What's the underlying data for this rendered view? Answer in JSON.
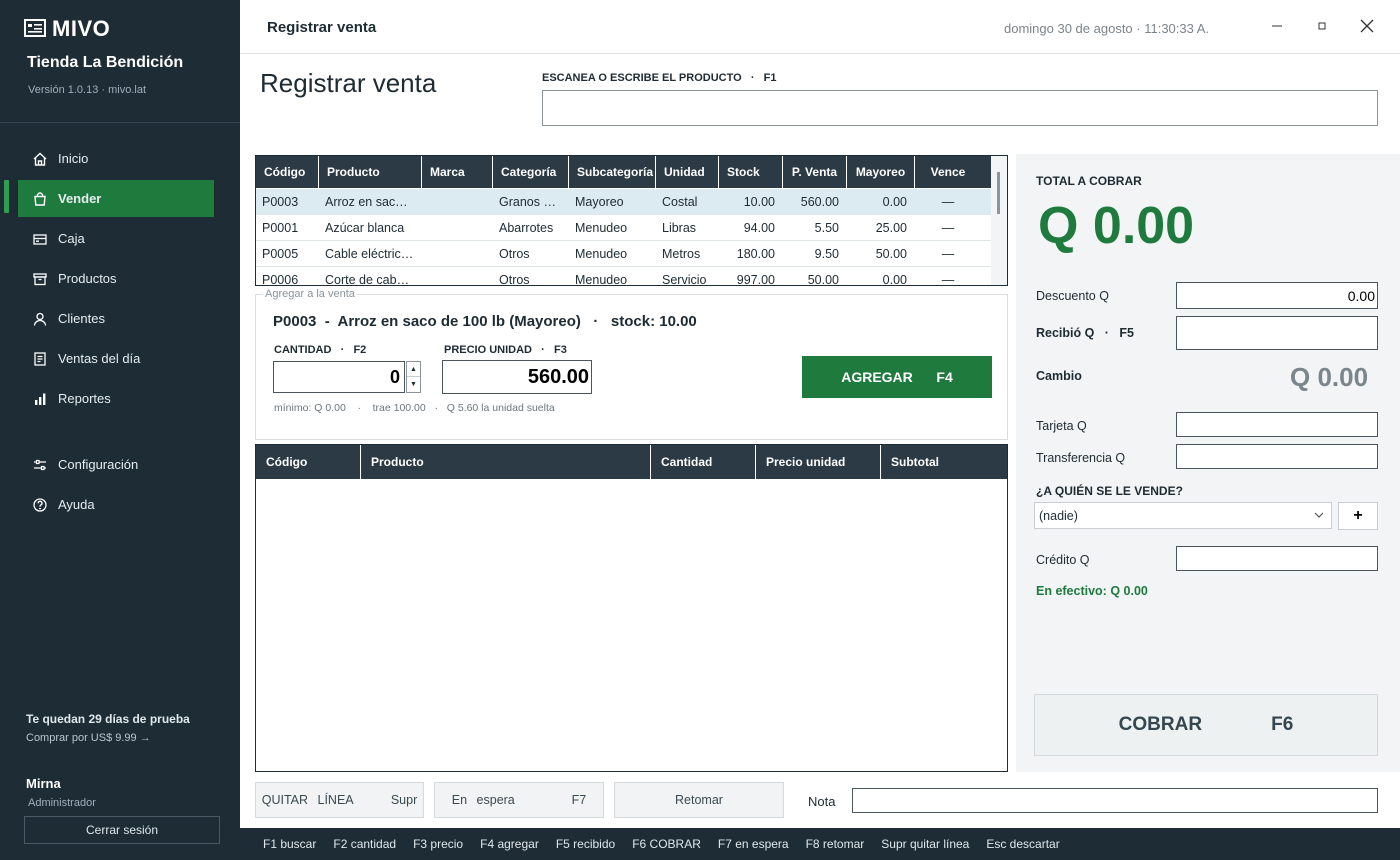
{
  "sidebar": {
    "logo": "MIVO",
    "store_name": "Tienda La Bendición",
    "version": "Versión 1.0.13 · mivo.lat",
    "items": [
      {
        "label": "Inicio"
      },
      {
        "label": "Vender"
      },
      {
        "label": "Caja"
      },
      {
        "label": "Productos"
      },
      {
        "label": "Clientes"
      },
      {
        "label": "Ventas del día"
      },
      {
        "label": "Reportes"
      },
      {
        "label": "Configuración"
      },
      {
        "label": "Ayuda"
      }
    ],
    "trial": "Te quedan 29 días de prueba",
    "trial_link": "Comprar por US$ 9.99 →",
    "user_name": "Mirna",
    "user_role": "Administrador",
    "logout": "Cerrar sesión"
  },
  "window": {
    "title": "Registrar venta",
    "datetime": "domingo 30 de agosto   ·   11:30:33 A."
  },
  "page": {
    "title": "Registrar venta",
    "scan_label": "ESCANEA O ESCRIBE EL PRODUCTO   ·   F1",
    "scan_value": ""
  },
  "products_table": {
    "headers": [
      "Código",
      "Producto",
      "Marca",
      "Categoría",
      "Subcategoría",
      "Unidad",
      "Stock",
      "P. Venta",
      "Mayoreo",
      "Vence"
    ],
    "rows": [
      [
        "P0003",
        "Arroz en sac…",
        "",
        "Granos …",
        "Mayoreo",
        "Costal",
        "10.00",
        "560.00",
        "0.00",
        "—"
      ],
      [
        "P0001",
        "Azúcar blanca",
        "",
        "Abarrotes",
        "Menudeo",
        "Libras",
        "94.00",
        "5.50",
        "25.00",
        "—"
      ],
      [
        "P0005",
        "Cable eléctric…",
        "",
        "Otros",
        "Menudeo",
        "Metros",
        "180.00",
        "9.50",
        "50.00",
        "—"
      ],
      [
        "P0006",
        "Corte de cab…",
        "",
        "Otros",
        "Menudeo",
        "Servicio",
        "997.00",
        "50.00",
        "0.00",
        "—"
      ]
    ]
  },
  "add_panel": {
    "legend": "Agregar a la venta",
    "product_line": "P0003  -  Arroz en saco de 100 lb (Mayoreo)   ·   stock: 10.00",
    "qty_label": "CANTIDAD   ·   F2",
    "qty_value": "0",
    "price_label": "PRECIO UNIDAD   ·   F3",
    "price_value": "560.00",
    "hint": "mínimo: Q 0.00    ·    trae 100.00   ·   Q 5.60 la unidad suelta",
    "add_button": "AGREGAR   F4"
  },
  "cart_table": {
    "headers": [
      "Código",
      "Producto",
      "Cantidad",
      "Precio unidad",
      "Subtotal"
    ]
  },
  "checkout": {
    "total_label": "TOTAL A COBRAR",
    "total_value": "Q 0.00",
    "discount_label": "Descuento Q",
    "discount_value": "0.00",
    "received_label": "Recibió Q   ·   F5",
    "received_value": "",
    "change_label": "Cambio",
    "change_value": "Q 0.00",
    "card_label": "Tarjeta Q",
    "transfer_label": "Transferencia Q",
    "customer_label": "¿A QUIÉN SE LE VENDE?",
    "customer_value": "(nadie)",
    "add_customer": "+",
    "credit_label": "Crédito Q",
    "cash_label": "En efectivo: Q 0.00",
    "charge_button": "COBRAR    F6"
  },
  "bottom": {
    "remove_line": "QUITAR LÍNEA    Supr",
    "on_hold": "En espera      F7",
    "resume": "Retomar",
    "note_label": "Nota"
  },
  "shortcuts": [
    "F1 buscar",
    "F2 cantidad",
    "F3 precio",
    "F4 agregar",
    "F5 recibido",
    "F6 COBRAR",
    "F7 en espera",
    "F8 retomar",
    "Supr quitar línea",
    "Esc descartar"
  ],
  "colors": {
    "sidebar": "#1d2c35",
    "accent_green": "#1f7a3e",
    "table_header": "#2b3a44"
  }
}
